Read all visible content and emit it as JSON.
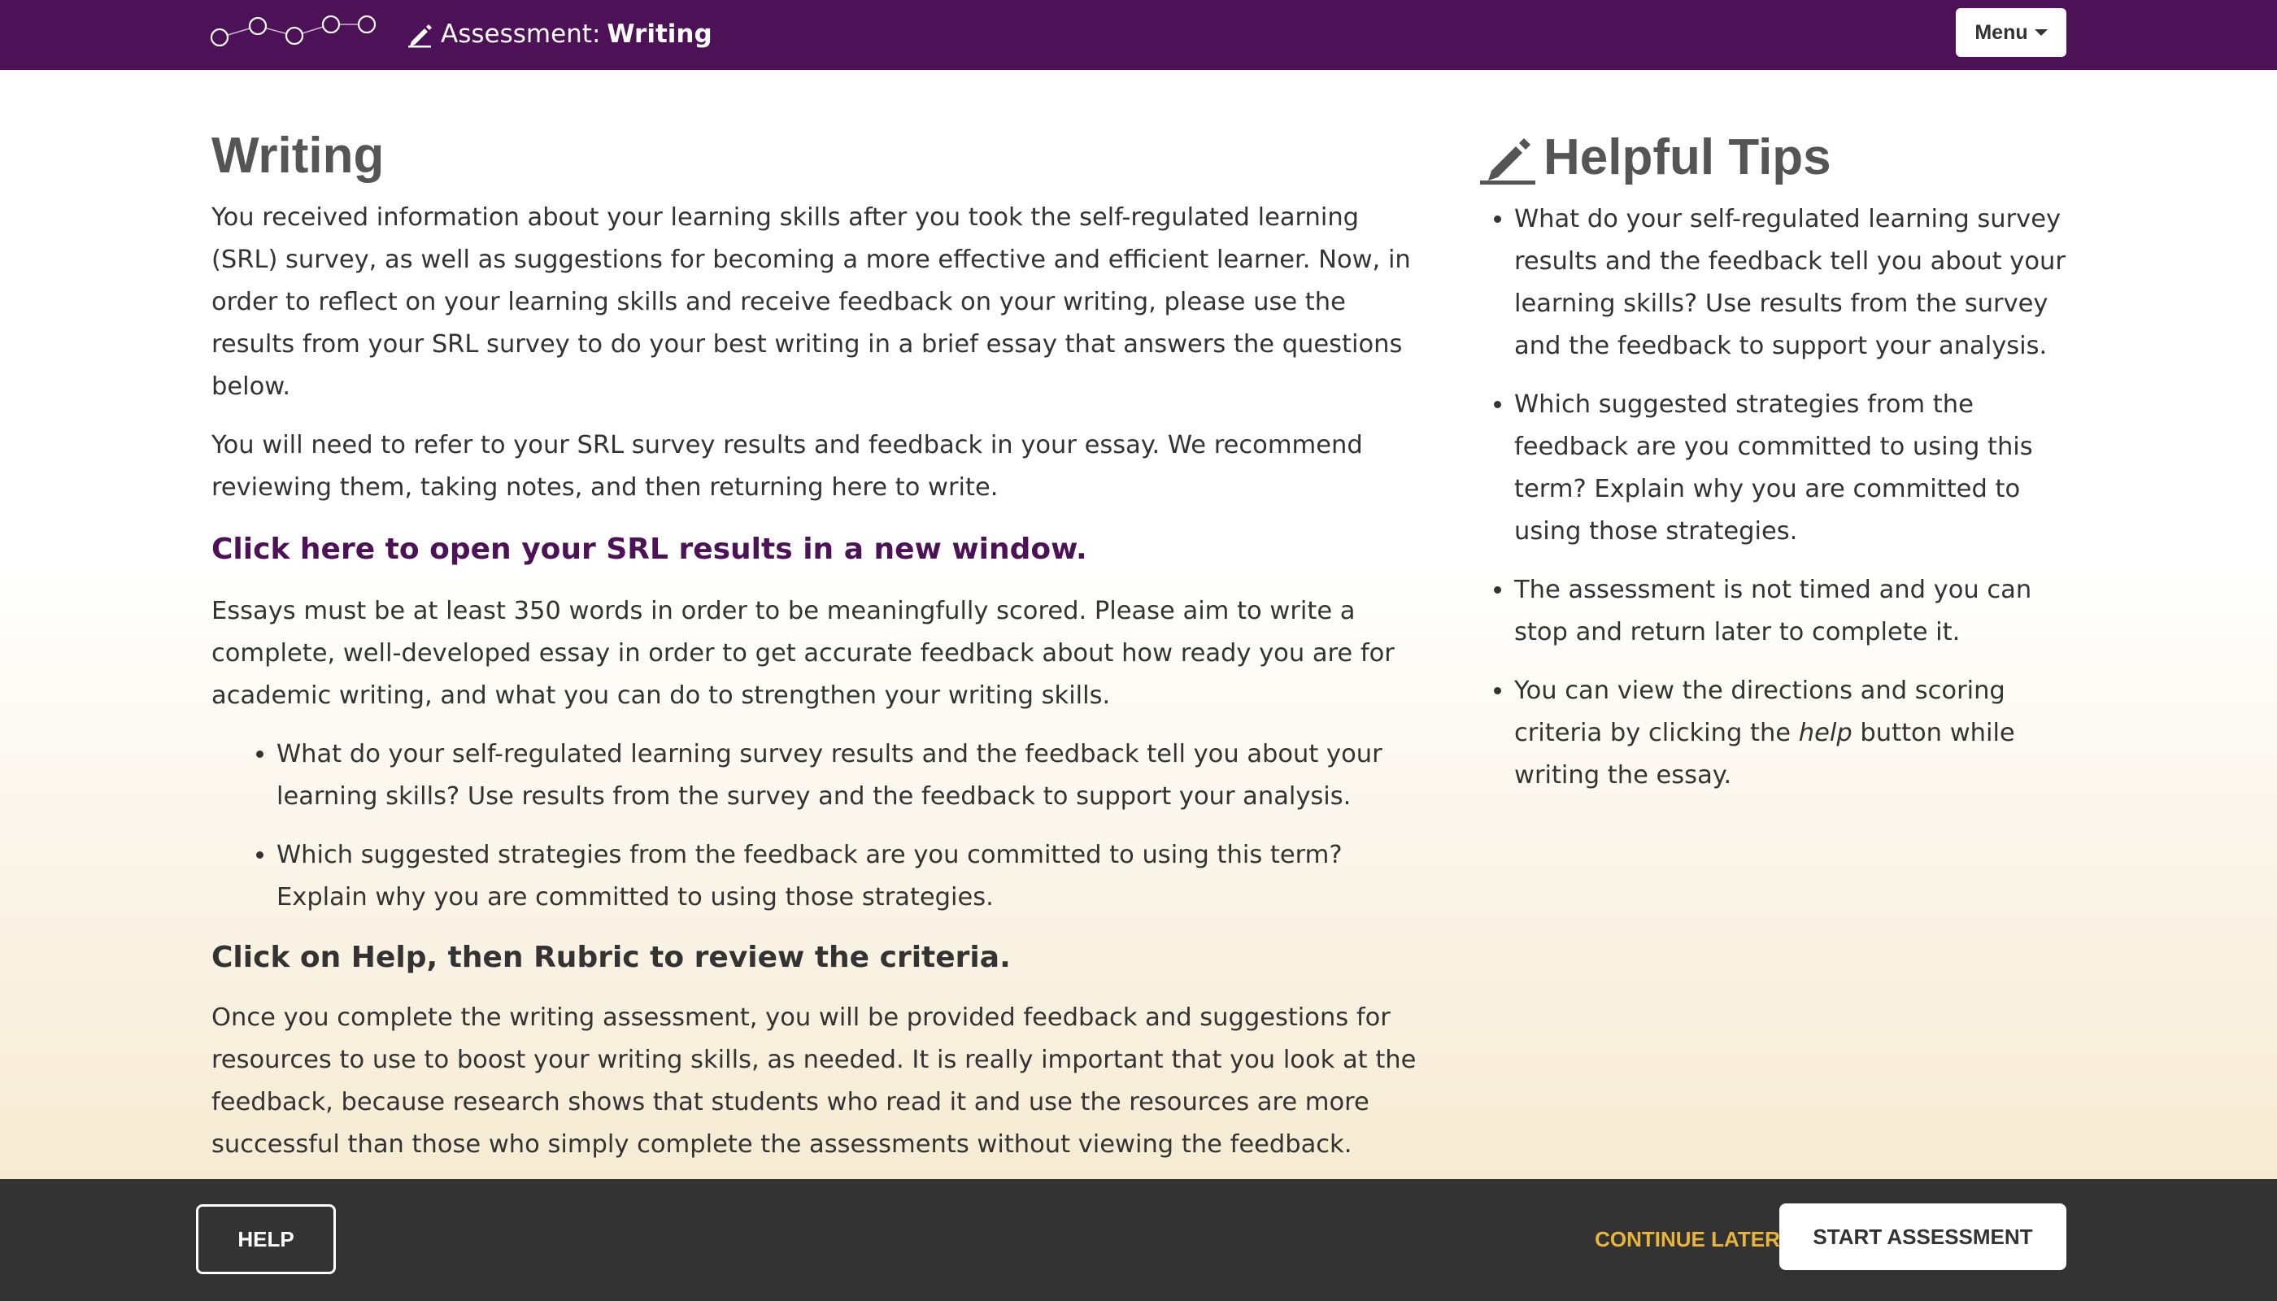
{
  "header": {
    "title_prefix": "Assessment:",
    "title_bold": "Writing",
    "menu_label": "Menu",
    "brand_color": "#4d1157",
    "icons": [
      "network-logo-icon",
      "pencil-icon",
      "caret-down-icon"
    ]
  },
  "main": {
    "heading": "Writing",
    "para1": "You received information about your learning skills after you took the self-regulated learning (SRL) survey, as well as suggestions for becoming a more effective and efficient learner. Now, in order to reflect on your learning skills and receive feedback on your writing, please use the results from your SRL survey to do your best writing in a brief essay that answers the questions below.",
    "para2": "You will need to refer to your SRL survey results and feedback in your essay. We recommend reviewing them, taking notes, and then returning here to write.",
    "link": "Click here to open your SRL results in a new window.",
    "para3": "Essays must be at least 350 words in order to be meaningfully scored. Please aim to write a complete, well-developed essay in order to get accurate feedback about how ready you are for academic writing, and what you can do to strengthen your writing skills.",
    "questions": [
      "What do your self-regulated learning survey results and the feedback tell you about your learning skills? Use results from the survey and the feedback to support your analysis.",
      "Which suggested strategies from the feedback are you committed to using this term? Explain why you are committed to using those strategies."
    ],
    "subheading": "Click on Help, then Rubric to review the criteria.",
    "para4": "Once you complete the writing assessment, you will be provided feedback and suggestions for resources to use to boost your writing skills, as needed. It is really important that you look at the feedback, because research shows that students who read it and use the resources are more successful than those who simply complete the assessments without viewing the feedback."
  },
  "sidebar": {
    "heading": "Helpful Tips",
    "tips": [
      "What do your self-regulated learning survey results and the feedback tell you about your learning skills? Use results from the survey and the feedback to support your analysis.",
      "Which suggested strategies from the feedback are you committed to using this term? Explain why you are committed to using those strategies.",
      "The assessment is not timed and you can stop and return later to complete it."
    ],
    "tip4_before": "You can view the directions and scoring criteria by clicking the ",
    "tip4_em": "help",
    "tip4_after": " button while writing the essay."
  },
  "footer": {
    "help_label": "HELP",
    "continue_label": "CONTINUE LATER",
    "start_label": "START ASSESSMENT",
    "continue_color": "#e8b43a"
  }
}
